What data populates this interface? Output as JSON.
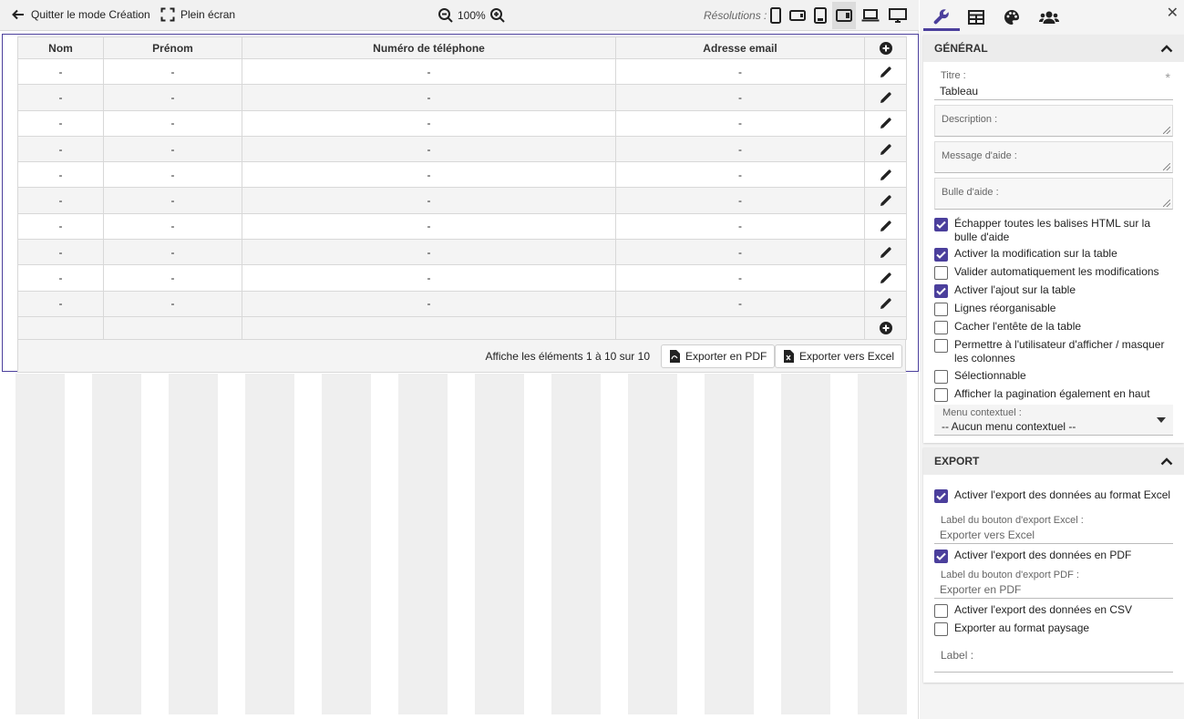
{
  "toolbar": {
    "quit_label": "Quitter le mode Création",
    "fullscreen_label": "Plein écran",
    "zoom_value": "100%",
    "resolutions_label": "Résolutions :"
  },
  "table": {
    "headers": [
      "Nom",
      "Prénom",
      "Numéro de téléphone",
      "Adresse email"
    ],
    "placeholder": "-",
    "row_count": 10,
    "footer_info": "Affiche les éléments 1 à 10 sur 10",
    "export_pdf": "Exporter en PDF",
    "export_excel": "Exporter vers Excel"
  },
  "panel": {
    "general": {
      "title": "Général",
      "titre_label": "Titre :",
      "titre_value": "Tableau",
      "required_mark": "*",
      "description_label": "Description :",
      "message_label": "Message d'aide :",
      "bulle_label": "Bulle d'aide :",
      "checkboxes": [
        {
          "label": "Échapper toutes les balises HTML sur la bulle d'aide",
          "checked": true
        },
        {
          "label": "Activer la modification sur la table",
          "checked": true
        },
        {
          "label": "Valider automatiquement les modifications",
          "checked": false
        },
        {
          "label": "Activer l'ajout sur la table",
          "checked": true
        },
        {
          "label": "Lignes réorganisable",
          "checked": false
        },
        {
          "label": "Cacher l'entête de la table",
          "checked": false
        },
        {
          "label": "Permettre à l'utilisateur d'afficher / masquer les colonnes",
          "checked": false
        },
        {
          "label": "Sélectionnable",
          "checked": false
        },
        {
          "label": "Afficher la pagination également en haut",
          "checked": false
        }
      ],
      "menu_label": "Menu contextuel :",
      "menu_value": "-- Aucun menu contextuel --"
    },
    "export": {
      "title": "Export",
      "cb_excel": "Activer l'export des données au format Excel",
      "excel_btn_label": "Label du bouton d'export Excel :",
      "excel_btn_value": "Exporter vers Excel",
      "cb_pdf": "Activer l'export des données en PDF",
      "pdf_btn_label": "Label du bouton d'export PDF :",
      "pdf_btn_value": "Exporter en PDF",
      "cb_csv": "Activer l'export des données en CSV",
      "cb_paysage": "Exporter au format paysage",
      "label_label": "Label :"
    }
  },
  "colors": {
    "accent": "#4b3f9c"
  }
}
